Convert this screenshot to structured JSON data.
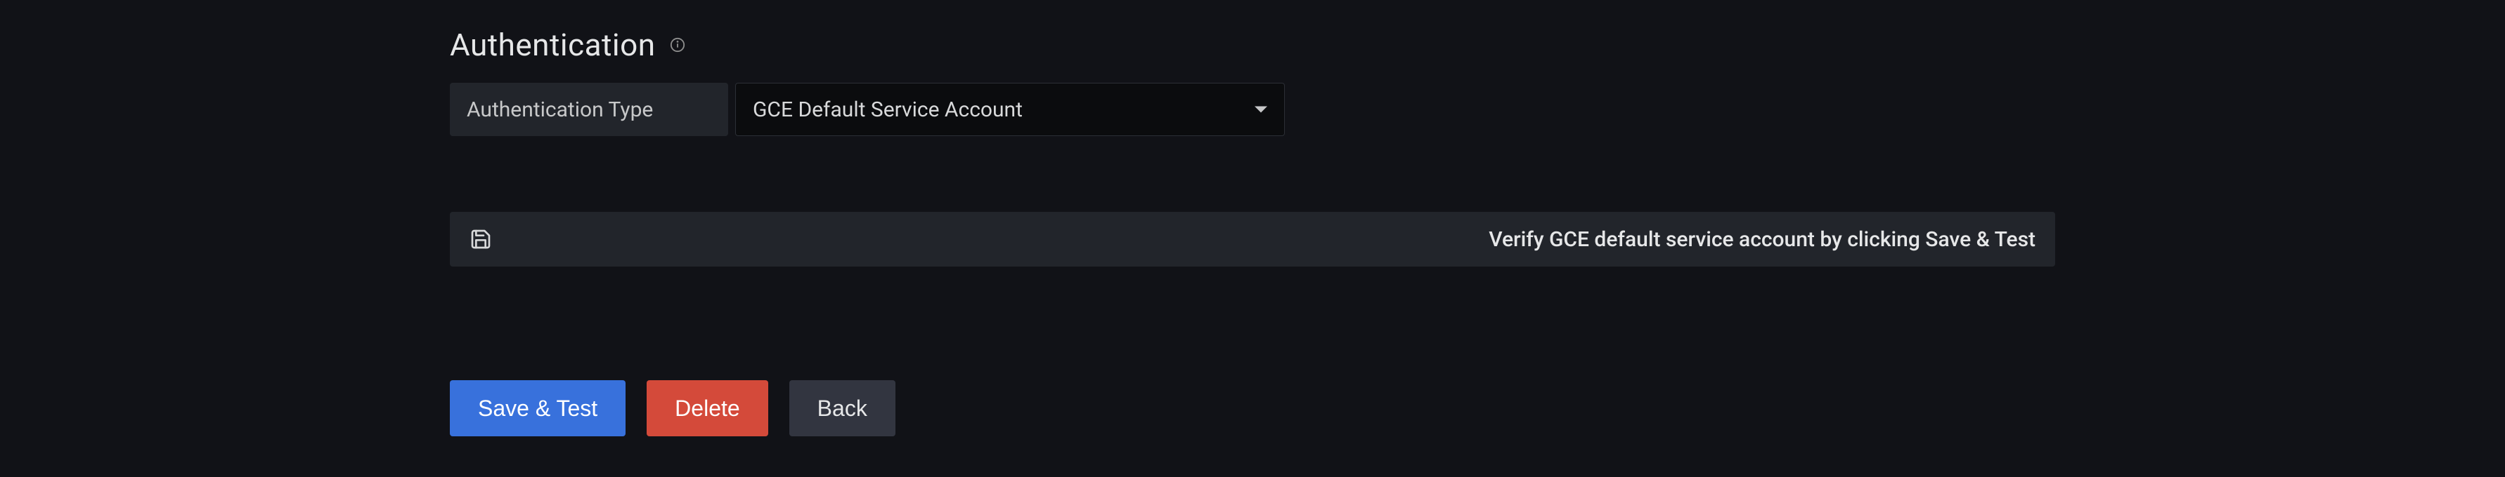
{
  "section": {
    "title": "Authentication"
  },
  "form": {
    "auth_type_label": "Authentication Type",
    "auth_type_value": "GCE Default Service Account"
  },
  "alert": {
    "message": "Verify GCE default service account by clicking Save & Test"
  },
  "buttons": {
    "save_test": "Save & Test",
    "delete": "Delete",
    "back": "Back"
  }
}
